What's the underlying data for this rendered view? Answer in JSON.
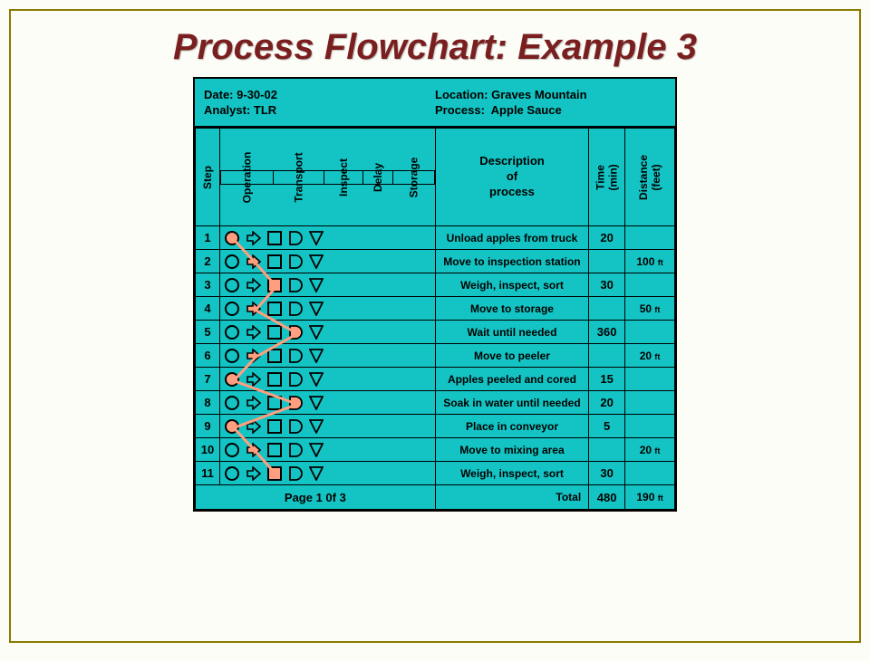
{
  "title": "Process Flowchart: Example 3",
  "meta": {
    "date_label": "Date:",
    "date_value": "9-30-02",
    "analyst_label": "Analyst:",
    "analyst_value": "TLR",
    "location_label": "Location:",
    "location_value": "Graves Mountain",
    "process_label": "Process:",
    "process_value": "Apple Sauce"
  },
  "headers": {
    "step": "Step",
    "symbols": [
      "Operation",
      "Transport",
      "Inspect",
      "Delay",
      "Storage"
    ],
    "description": "Description\nof\nprocess",
    "time": "Time\n(min)",
    "distance": "Distance\n(feet)"
  },
  "rows": [
    {
      "step": "1",
      "active": 0,
      "desc": "Unload apples from truck",
      "time": "20",
      "dist": ""
    },
    {
      "step": "2",
      "active": 1,
      "desc": "Move to inspection station",
      "time": "",
      "dist": "100"
    },
    {
      "step": "3",
      "active": 2,
      "desc": "Weigh, inspect, sort",
      "time": "30",
      "dist": ""
    },
    {
      "step": "4",
      "active": 1,
      "desc": "Move to storage",
      "time": "",
      "dist": "50"
    },
    {
      "step": "5",
      "active": 3,
      "desc": "Wait until needed",
      "time": "360",
      "dist": ""
    },
    {
      "step": "6",
      "active": 1,
      "desc": "Move to peeler",
      "time": "",
      "dist": "20"
    },
    {
      "step": "7",
      "active": 0,
      "desc": "Apples peeled and cored",
      "time": "15",
      "dist": ""
    },
    {
      "step": "8",
      "active": 3,
      "desc": "Soak in water until needed",
      "time": "20",
      "dist": ""
    },
    {
      "step": "9",
      "active": 0,
      "desc": "Place in conveyor",
      "time": "5",
      "dist": ""
    },
    {
      "step": "10",
      "active": 1,
      "desc": "Move to mixing area",
      "time": "",
      "dist": "20"
    },
    {
      "step": "11",
      "active": 2,
      "desc": "Weigh, inspect, sort",
      "time": "30",
      "dist": ""
    }
  ],
  "footer": {
    "page": "Page 1 0f 3",
    "total_label": "Total",
    "total_time": "480",
    "total_dist": "190"
  },
  "ft_unit": "ft",
  "chart_data": {
    "type": "table",
    "title": "Process Flowchart: Example 3",
    "symbol_columns": [
      "Operation",
      "Transport",
      "Inspect",
      "Delay",
      "Storage"
    ],
    "steps": [
      {
        "step": 1,
        "symbol": "Operation",
        "description": "Unload apples from truck",
        "time_min": 20,
        "distance_ft": null
      },
      {
        "step": 2,
        "symbol": "Transport",
        "description": "Move to inspection station",
        "time_min": null,
        "distance_ft": 100
      },
      {
        "step": 3,
        "symbol": "Inspect",
        "description": "Weigh, inspect, sort",
        "time_min": 30,
        "distance_ft": null
      },
      {
        "step": 4,
        "symbol": "Transport",
        "description": "Move to storage",
        "time_min": null,
        "distance_ft": 50
      },
      {
        "step": 5,
        "symbol": "Delay",
        "description": "Wait until needed",
        "time_min": 360,
        "distance_ft": null
      },
      {
        "step": 6,
        "symbol": "Transport",
        "description": "Move to peeler",
        "time_min": null,
        "distance_ft": 20
      },
      {
        "step": 7,
        "symbol": "Operation",
        "description": "Apples peeled and cored",
        "time_min": 15,
        "distance_ft": null
      },
      {
        "step": 8,
        "symbol": "Delay",
        "description": "Soak in water until needed",
        "time_min": 20,
        "distance_ft": null
      },
      {
        "step": 9,
        "symbol": "Operation",
        "description": "Place in conveyor",
        "time_min": 5,
        "distance_ft": null
      },
      {
        "step": 10,
        "symbol": "Transport",
        "description": "Move to mixing area",
        "time_min": null,
        "distance_ft": 20
      },
      {
        "step": 11,
        "symbol": "Inspect",
        "description": "Weigh, inspect, sort",
        "time_min": 30,
        "distance_ft": null
      }
    ],
    "totals": {
      "time_min": 480,
      "distance_ft": 190
    },
    "meta": {
      "date": "9-30-02",
      "analyst": "TLR",
      "location": "Graves Mountain",
      "process": "Apple Sauce",
      "page": "1 of 3"
    }
  }
}
